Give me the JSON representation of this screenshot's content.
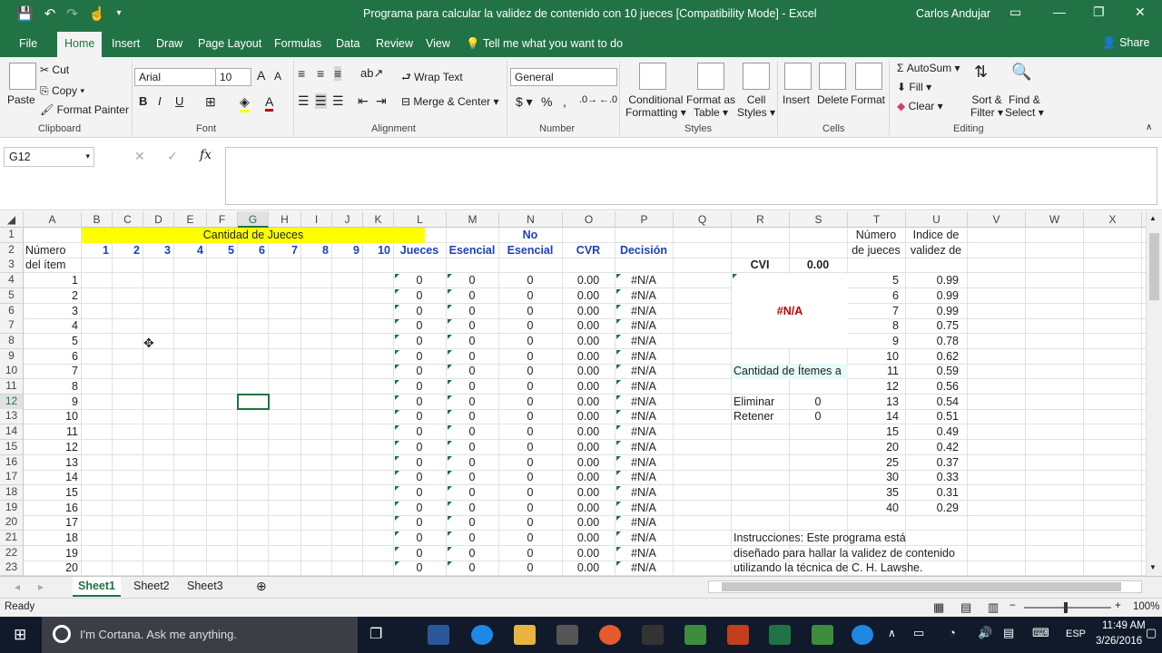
{
  "titlebar": {
    "title": "Programa para calcular la validez de contenido con 10 jueces  [Compatibility Mode] - Excel",
    "user": "Carlos Andujar"
  },
  "tabs": [
    "File",
    "Home",
    "Insert",
    "Draw",
    "Page Layout",
    "Formulas",
    "Data",
    "Review",
    "View"
  ],
  "tell_me": "Tell me what you want to do",
  "share": "Share",
  "ribbon": {
    "clipboard": {
      "paste": "Paste",
      "cut": "Cut",
      "copy": "Copy",
      "format_painter": "Format Painter",
      "label": "Clipboard"
    },
    "font": {
      "name": "Arial",
      "size": "10",
      "label": "Font"
    },
    "alignment": {
      "wrap": "Wrap Text",
      "merge": "Merge & Center",
      "label": "Alignment"
    },
    "number": {
      "format": "General",
      "label": "Number"
    },
    "styles": {
      "conditional": "Conditional",
      "conditional2": "Formatting",
      "format_as": "Format as",
      "table": "Table",
      "cell": "Cell",
      "styles_lbl": "Styles",
      "label": "Styles"
    },
    "cells": {
      "insert": "Insert",
      "delete": "Delete",
      "format": "Format",
      "label": "Cells"
    },
    "editing": {
      "autosum": "AutoSum",
      "fill": "Fill",
      "clear": "Clear",
      "sort1": "Sort &",
      "sort2": "Filter",
      "find1": "Find &",
      "find2": "Select",
      "label": "Editing"
    }
  },
  "formula_bar": {
    "name_box": "G12",
    "formula": ""
  },
  "columns": [
    "A",
    "B",
    "C",
    "D",
    "E",
    "F",
    "G",
    "H",
    "I",
    "J",
    "K",
    "L",
    "M",
    "N",
    "O",
    "P",
    "Q",
    "R",
    "S",
    "T",
    "U",
    "V",
    "W",
    "X"
  ],
  "rows": [
    "1",
    "2",
    "3",
    "4",
    "5",
    "6",
    "7",
    "8",
    "9",
    "10",
    "11",
    "12",
    "13",
    "14",
    "15",
    "16",
    "17",
    "18",
    "19",
    "20",
    "21",
    "22",
    "23"
  ],
  "sheet": {
    "header_jueces": "Cantidad de Jueces",
    "judge_numbers": [
      "1",
      "2",
      "3",
      "4",
      "5",
      "6",
      "7",
      "8",
      "9",
      "10"
    ],
    "numero_item_1": "Número",
    "numero_item_2": "del ítem",
    "col_jueces": "Jueces",
    "col_esencial": "Esencial",
    "col_no_esencial_1": "No",
    "col_no_esencial_2": "Esencial",
    "col_cvr": "CVR",
    "col_decision": "Decisión",
    "items": [
      "1",
      "2",
      "3",
      "4",
      "5",
      "6",
      "7",
      "8",
      "9",
      "10",
      "11",
      "12",
      "13",
      "14",
      "15",
      "16",
      "17",
      "18",
      "19",
      "20"
    ],
    "jueces_val": "0",
    "esencial_val": "0",
    "no_esencial_val": "0",
    "cvr_val": "0.00",
    "decision_val": "#N/A",
    "cvi_label": "CVI",
    "cvi_value": "0.00",
    "na_value": "#N/A",
    "cantidad_items": "Cantidad de Ítemes a",
    "eliminar_label": "Eliminar",
    "eliminar_value": "0",
    "retener_label": "Retener",
    "retener_value": "0",
    "t_header_1": "Número",
    "t_header_2": "de jueces",
    "u_header_1": "Indice de",
    "u_header_2": "validez de",
    "ref_judges": [
      "5",
      "6",
      "7",
      "8",
      "9",
      "10",
      "11",
      "12",
      "13",
      "14",
      "15",
      "20",
      "25",
      "30",
      "35",
      "40"
    ],
    "ref_values": [
      "0.99",
      "0.99",
      "0.99",
      "0.75",
      "0.78",
      "0.62",
      "0.59",
      "0.56",
      "0.54",
      "0.51",
      "0.49",
      "0.42",
      "0.37",
      "0.33",
      "0.31",
      "0.29"
    ],
    "instr_1": "Instrucciones:  Este programa está",
    "instr_2": "diseñado para hallar la validez de contenido",
    "instr_3": "utilizando la técnica de C. H. Lawshe."
  },
  "sheet_tabs": [
    "Sheet1",
    "Sheet2",
    "Sheet3"
  ],
  "status": {
    "ready": "Ready",
    "zoom": "100%"
  },
  "taskbar": {
    "cortana": "I'm Cortana. Ask me anything.",
    "time": "11:49 AM",
    "date": "3/26/2016",
    "lang": "ESP"
  },
  "colors": {
    "excel_green": "#217346",
    "yellow": "#ffff00",
    "blue_header": "#1f3fbf",
    "red_na": "#c00000",
    "cyan_band": "#e6fafa"
  }
}
